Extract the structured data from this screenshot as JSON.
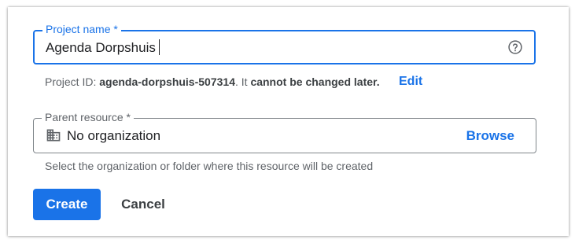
{
  "form": {
    "project_name": {
      "label": "Project name *",
      "value": "Agenda Dorpshuis",
      "help_icon": "help-circle-icon"
    },
    "project_id": {
      "prefix": "Project ID: ",
      "id": "agenda-dorpshuis-507314",
      "middle": ". It ",
      "emphasis": "cannot be changed later.",
      "edit_label": "Edit"
    },
    "parent_resource": {
      "label": "Parent resource *",
      "value": "No organization",
      "icon": "organization-building-icon",
      "browse_label": "Browse",
      "hint": "Select the organization or folder where this resource will be created"
    }
  },
  "actions": {
    "create_label": "Create",
    "cancel_label": "Cancel"
  },
  "colors": {
    "accent": "#1a73e8",
    "text_primary": "#202124",
    "text_secondary": "#5f6368",
    "border": "#80868b"
  }
}
